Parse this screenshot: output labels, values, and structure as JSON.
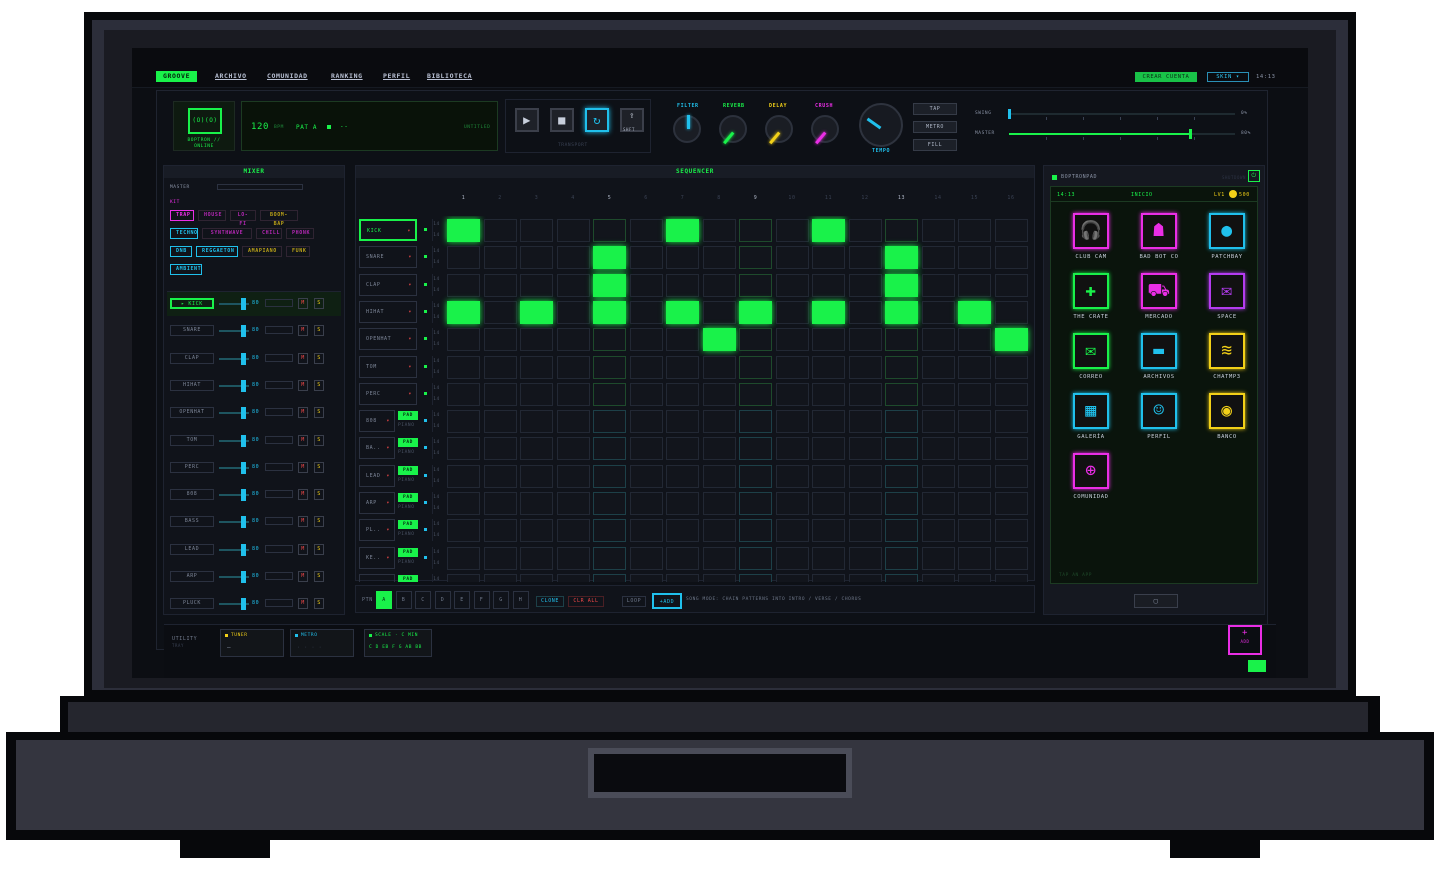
{
  "nav": {
    "items": [
      "GROOVE",
      "ARCHIVO",
      "COMUNIDAD",
      "RANKING",
      "PERFIL",
      "BIBLIOTECA"
    ],
    "active": 0,
    "crear": "CREAR CUENTA",
    "skin": "SKIN ▾",
    "clock": "14:13"
  },
  "device": {
    "face": "(o)(o)",
    "status": "BOPTRON // ONLINE"
  },
  "display": {
    "bpm": "120",
    "bpm_unit": "BPM",
    "pattern": "PAT A",
    "dash": "--",
    "title": "UNTITLED"
  },
  "transport": {
    "label": "TRANSPORT",
    "shift": "SHFT"
  },
  "knobs": [
    {
      "label": "FILTER",
      "color": "#20c0ec"
    },
    {
      "label": "REVERB",
      "color": "#19f24a"
    },
    {
      "label": "DELAY",
      "color": "#f2d018"
    },
    {
      "label": "CRUSH",
      "color": "#ea2ee6"
    }
  ],
  "tempo": {
    "label": "TEMPO"
  },
  "side_buttons": [
    "TAP",
    "METRO",
    "FILL"
  ],
  "sliders": [
    {
      "label": "SWING",
      "value": "0%",
      "fill": 0.0
    },
    {
      "label": "MASTER",
      "value": "80%",
      "fill": 0.8
    }
  ],
  "mixer": {
    "title": "MIXER",
    "master": "MASTER",
    "kit_label": "KIT",
    "kits": [
      {
        "name": "TRAP",
        "color": "#ea2ee6"
      },
      {
        "name": "HOUSE",
        "color": "#ea2ee6"
      },
      {
        "name": "LO-FI",
        "color": "#ea2ee6"
      },
      {
        "name": "BOOM-BAP",
        "color": "#f2d018"
      },
      {
        "name": "TECHNO",
        "color": "#20c0ec"
      },
      {
        "name": "SYNTHWAVE",
        "color": "#ea2ee6"
      },
      {
        "name": "CHILL",
        "color": "#ea2ee6"
      },
      {
        "name": "PHONK",
        "color": "#ea2ee6"
      },
      {
        "name": "DNB",
        "color": "#20c0ec"
      },
      {
        "name": "REGGAETON",
        "color": "#20c0ec"
      },
      {
        "name": "AMAPIANO",
        "color": "#f2d018"
      },
      {
        "name": "FUNK",
        "color": "#f2d018"
      },
      {
        "name": "AMBIENT",
        "color": "#20c0ec"
      }
    ],
    "channels": [
      "▸ KICK",
      "SNARE",
      "CLAP",
      "HIHAT",
      "OPENHAT",
      "TOM",
      "PERC",
      "808",
      "BASS",
      "LEAD",
      "ARP",
      "PLUCK"
    ],
    "level": "80",
    "mute": "M",
    "solo": "S"
  },
  "sequencer": {
    "title": "SEQUENCER",
    "steps": [
      "1",
      "2",
      "3",
      "4",
      "5",
      "6",
      "7",
      "8",
      "9",
      "10",
      "11",
      "12",
      "13",
      "14",
      "15",
      "16"
    ],
    "tracks": [
      "KICK",
      "SNARE",
      "CLAP",
      "HIHAT",
      "OPENHAT",
      "TOM",
      "PERC",
      "808",
      "BA..",
      "LEAD",
      "ARP",
      "PL..",
      "KE..",
      ""
    ],
    "pad_label": "PAD",
    "piano_label": "PIANO",
    "vol": "14",
    "grid": [
      [
        1,
        0,
        0,
        0,
        0,
        0,
        1,
        0,
        0,
        0,
        1,
        0,
        0,
        0,
        0,
        0
      ],
      [
        0,
        0,
        0,
        0,
        1,
        0,
        0,
        0,
        0,
        0,
        0,
        0,
        1,
        0,
        0,
        0
      ],
      [
        0,
        0,
        0,
        0,
        1,
        0,
        0,
        0,
        0,
        0,
        0,
        0,
        1,
        0,
        0,
        0
      ],
      [
        1,
        0,
        1,
        0,
        1,
        0,
        1,
        0,
        1,
        0,
        1,
        0,
        1,
        0,
        1,
        0
      ],
      [
        0,
        0,
        0,
        0,
        0,
        0,
        0,
        1,
        0,
        0,
        0,
        0,
        0,
        0,
        0,
        1
      ],
      [
        0,
        0,
        0,
        0,
        0,
        0,
        0,
        0,
        0,
        0,
        0,
        0,
        0,
        0,
        0,
        0
      ],
      [
        0,
        0,
        0,
        0,
        0,
        0,
        0,
        0,
        0,
        0,
        0,
        0,
        0,
        0,
        0,
        0
      ],
      [
        0,
        0,
        0,
        0,
        0,
        0,
        0,
        0,
        0,
        0,
        0,
        0,
        0,
        0,
        0,
        0
      ],
      [
        0,
        0,
        0,
        0,
        0,
        0,
        0,
        0,
        0,
        0,
        0,
        0,
        0,
        0,
        0,
        0
      ],
      [
        0,
        0,
        0,
        0,
        0,
        0,
        0,
        0,
        0,
        0,
        0,
        0,
        0,
        0,
        0,
        0
      ],
      [
        0,
        0,
        0,
        0,
        0,
        0,
        0,
        0,
        0,
        0,
        0,
        0,
        0,
        0,
        0,
        0
      ],
      [
        0,
        0,
        0,
        0,
        0,
        0,
        0,
        0,
        0,
        0,
        0,
        0,
        0,
        0,
        0,
        0
      ],
      [
        0,
        0,
        0,
        0,
        0,
        0,
        0,
        0,
        0,
        0,
        0,
        0,
        0,
        0,
        0,
        0
      ],
      [
        0,
        0,
        0,
        0,
        0,
        0,
        0,
        0,
        0,
        0,
        0,
        0,
        0,
        0,
        0,
        0
      ]
    ],
    "bottom": {
      "ptn": "PTN",
      "patterns": [
        "A",
        "B",
        "C",
        "D",
        "E",
        "F",
        "G",
        "H"
      ],
      "clone": "CLONE",
      "clr": "CLR ALL",
      "loop": "LOOP",
      "add": "+ADD",
      "song": "SONG MODE: CHAIN PATTERNS INTO INTRO / VERSE / CHORUS"
    }
  },
  "pad": {
    "title": "BOPTRONPAD",
    "hint": "SHUTDOWN",
    "time": "14:13",
    "home": "INICIO",
    "level": "LV1",
    "coins": "500",
    "footer": "TAP AN APP",
    "apps": [
      {
        "name": "CLUB CAM",
        "color": "#ea2ee6",
        "icon": "🎧"
      },
      {
        "name": "BAD BOT CO",
        "color": "#ea2ee6",
        "icon": "☗"
      },
      {
        "name": "PATCHBAY",
        "color": "#20c0ec",
        "icon": "●"
      },
      {
        "name": "THE CRATE",
        "color": "#19f24a",
        "icon": "✚"
      },
      {
        "name": "MERCADO",
        "color": "#ea2ee6",
        "icon": "⛟"
      },
      {
        "name": "SPACE",
        "color": "#b43cf0",
        "icon": "✉"
      },
      {
        "name": "CORREO",
        "color": "#19f24a",
        "icon": "✉"
      },
      {
        "name": "ARCHIVOS",
        "color": "#20c0ec",
        "icon": "▬"
      },
      {
        "name": "CHATMP3",
        "color": "#f2d018",
        "icon": "≋"
      },
      {
        "name": "GALERÍA",
        "color": "#20c0ec",
        "icon": "▦"
      },
      {
        "name": "PERFIL",
        "color": "#20c0ec",
        "icon": "☺"
      },
      {
        "name": "BANCO",
        "color": "#f2d018",
        "icon": "◉"
      },
      {
        "name": "COMUNIDAD",
        "color": "#ea2ee6",
        "icon": "⊕"
      }
    ],
    "home_btn": "▢"
  },
  "utility": {
    "label": "UTILITY",
    "sub": "TRAY",
    "tuner": "TUNER",
    "tuner_val": "—",
    "metro": "METRO",
    "metro_val": "· · · ·",
    "scale": "SCALE · C MIN",
    "scale_notes": "C D Eb F G Ab Bb",
    "add": "+",
    "add_lbl": "ADD"
  }
}
